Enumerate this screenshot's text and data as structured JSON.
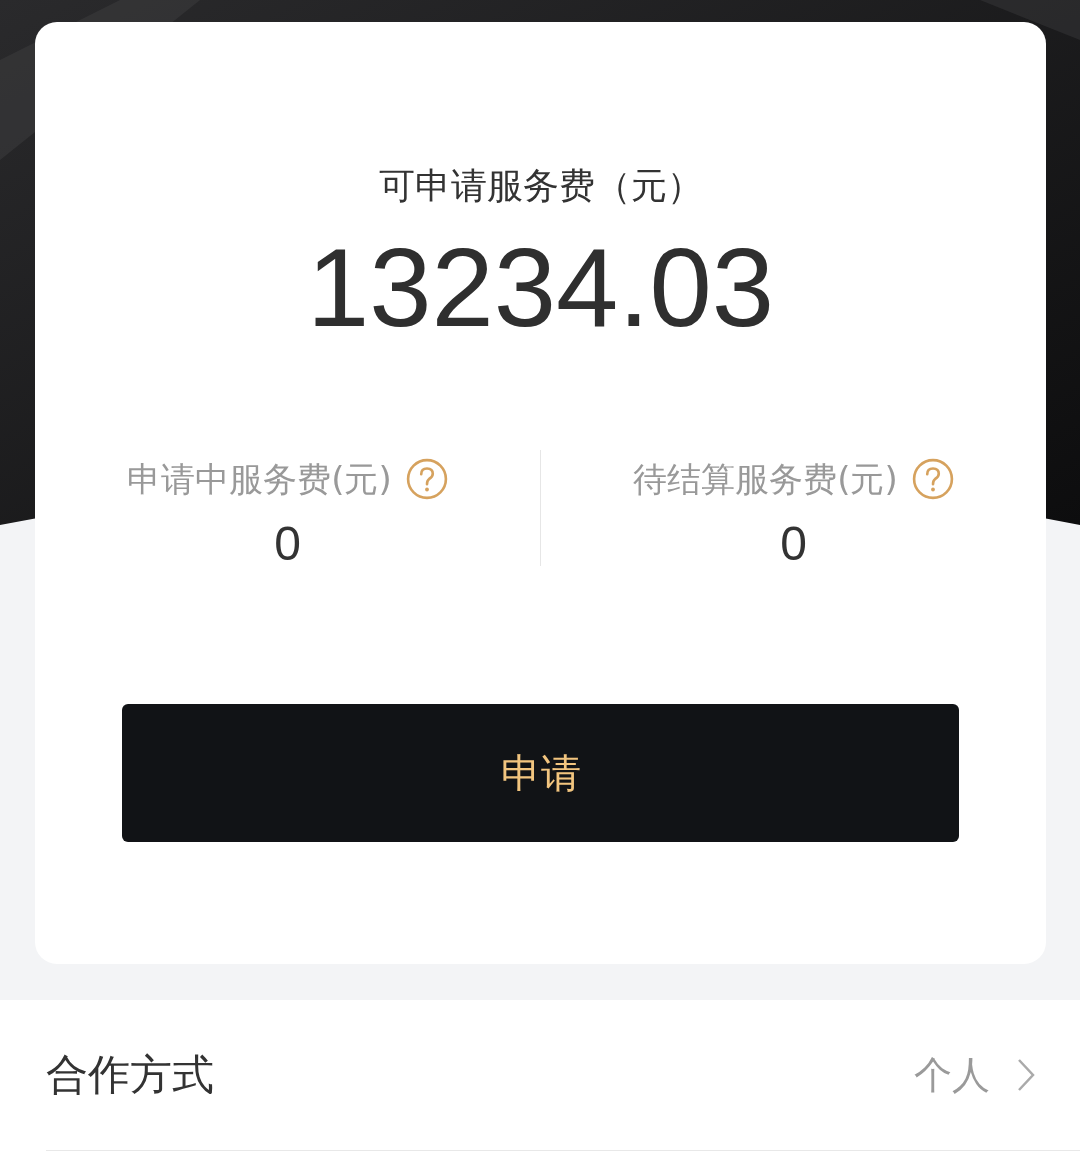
{
  "balance_card": {
    "title": "可申请服务费（元）",
    "amount": "13234.03",
    "stats": [
      {
        "label": "申请中服务费(元)",
        "value": "0"
      },
      {
        "label": "待结算服务费(元)",
        "value": "0"
      }
    ],
    "apply_button": "申请"
  },
  "cooperation_row": {
    "label": "合作方式",
    "value": "个人"
  }
}
